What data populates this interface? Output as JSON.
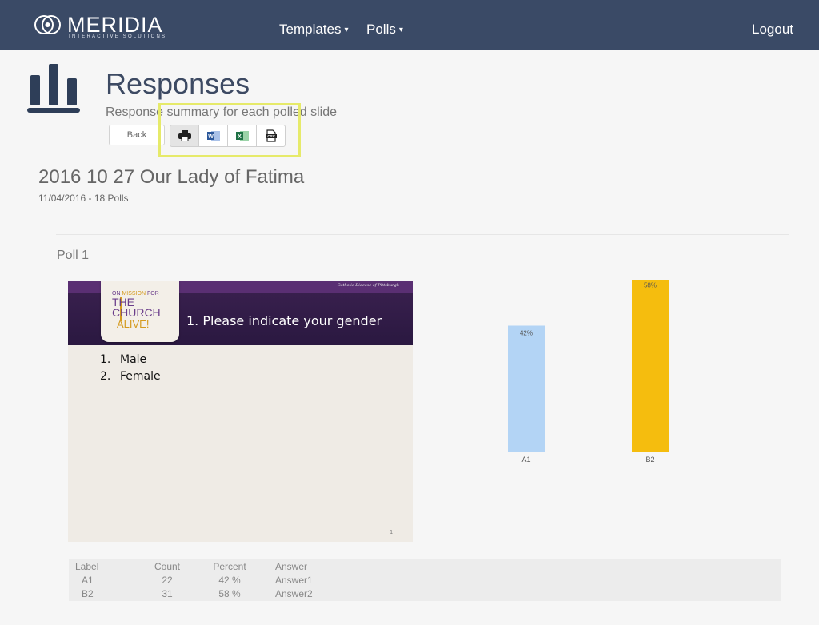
{
  "navbar": {
    "brand_name": "MERIDIA",
    "brand_tagline": "INTERACTIVE SOLUTIONS",
    "menu": [
      {
        "label": "Templates",
        "icon": "caret-down"
      },
      {
        "label": "Polls",
        "icon": "caret-down"
      }
    ],
    "logout_label": "Logout",
    "background": "#3a4a66"
  },
  "header": {
    "icon": "bar-chart-icon",
    "title": "Responses",
    "subtitle": "Response summary for each polled slide",
    "back_label": "Back",
    "export_buttons": [
      {
        "icon": "print-icon"
      },
      {
        "icon": "word-icon"
      },
      {
        "icon": "excel-icon"
      },
      {
        "icon": "csv-icon"
      }
    ],
    "highlight_color": "#e6ea6a"
  },
  "presentation": {
    "title": "2016 10 27 Our Lady of Fatima",
    "meta": "11/04/2016 - 18 Polls"
  },
  "poll": {
    "label": "Poll 1",
    "slide": {
      "badge_line1a": "ON ",
      "badge_line1b": "MISSION",
      "badge_line1c": " FOR",
      "badge_line2": "THE",
      "badge_line3": "CHURCH",
      "badge_line4": "ALIVE!",
      "diocese": "Catholic Diocese of Pittsburgh",
      "question": "1. Please indicate your gender",
      "answers": [
        {
          "num": "1.",
          "text": "Male"
        },
        {
          "num": "2.",
          "text": "Female"
        }
      ],
      "page_number": "1"
    },
    "chart_data": {
      "type": "bar",
      "categories": [
        "A1",
        "B2"
      ],
      "values": [
        42,
        58
      ],
      "data_labels": [
        "42%",
        "58%"
      ],
      "colors": [
        "#b3d4f5",
        "#f5bd0e"
      ],
      "ylim": [
        0,
        100
      ]
    },
    "table": {
      "headers": {
        "label": "Label",
        "count": "Count",
        "percent": "Percent",
        "answer": "Answer"
      },
      "rows": [
        {
          "label": "A1",
          "count": "22",
          "percent": "42 %",
          "answer": "Answer1"
        },
        {
          "label": "B2",
          "count": "31",
          "percent": "58 %",
          "answer": "Answer2"
        }
      ]
    }
  }
}
